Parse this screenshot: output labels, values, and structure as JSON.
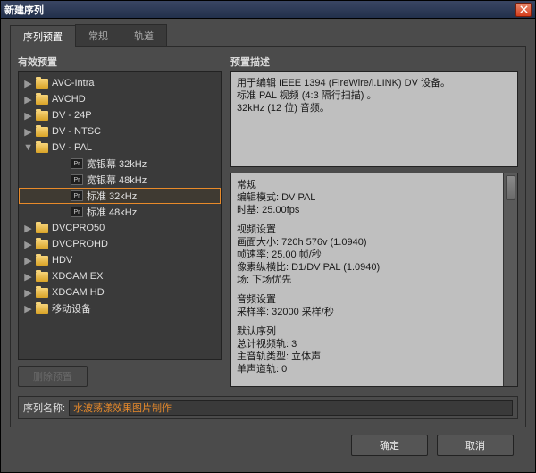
{
  "window": {
    "title": "新建序列"
  },
  "tabs": {
    "t0": "序列预置",
    "t1": "常规",
    "t2": "轨道"
  },
  "left": {
    "header": "有效预置",
    "items": {
      "avcintra": "AVC-Intra",
      "avchd": "AVCHD",
      "dv24p": "DV - 24P",
      "dvntsc": "DV - NTSC",
      "dvpal": "DV - PAL",
      "dvpal_ws32": "宽银幕 32kHz",
      "dvpal_ws48": "宽银幕 48kHz",
      "dvpal_std32": "标准 32kHz",
      "dvpal_std48": "标准 48kHz",
      "dvcpro50": "DVCPRO50",
      "dvcprohd": "DVCPROHD",
      "hdv": "HDV",
      "xdcamex": "XDCAM EX",
      "xdcamhd": "XDCAM HD",
      "mobile": "移动设备"
    }
  },
  "right": {
    "header": "预置描述",
    "desc": {
      "l1": "用于编辑 IEEE 1394 (FireWire/i.LINK) DV 设备。",
      "l2": "标准 PAL 视频 (4:3 隔行扫描) 。",
      "l3": "32kHz (12 位) 音频。"
    },
    "details": {
      "g1": "常规",
      "g1a": "编辑模式: DV PAL",
      "g1b": "时基: 25.00fps",
      "g2": "视频设置",
      "g2a": "画面大小: 720h 576v (1.0940)",
      "g2b": "帧速率: 25.00 帧/秒",
      "g2c": "像素纵横比: D1/DV PAL (1.0940)",
      "g2d": "场: 下场优先",
      "g3": "音频设置",
      "g3a": "采样率: 32000 采样/秒",
      "g4": "默认序列",
      "g4a": "总计视频轨: 3",
      "g4b": "主音轨类型: 立体声",
      "g4c": "单声道轨: 0"
    }
  },
  "buttons": {
    "delete": "删除预置",
    "ok": "确定",
    "cancel": "取消"
  },
  "seqname": {
    "label": "序列名称:",
    "value": "水波荡漾效果图片制作"
  }
}
